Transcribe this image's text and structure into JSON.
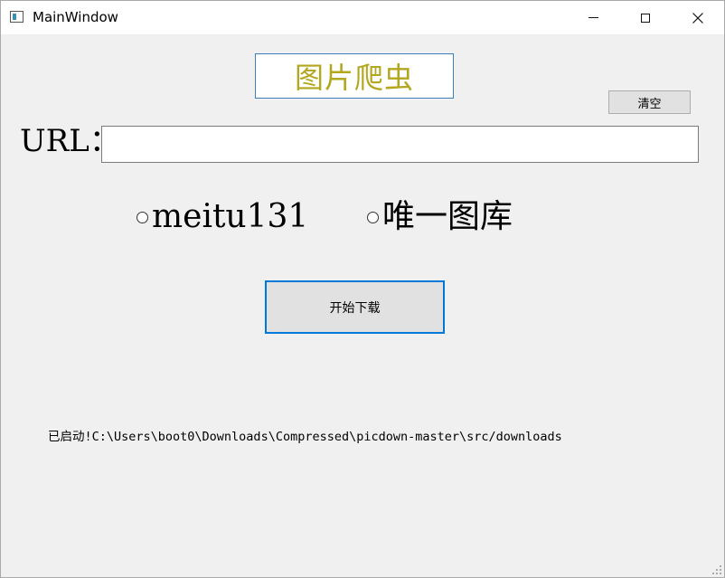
{
  "window": {
    "title": "MainWindow",
    "controls": {
      "minimize": "minimize",
      "maximize": "maximize",
      "close": "close"
    }
  },
  "header": {
    "title": "图片爬虫",
    "color": "#b3a71e"
  },
  "clear_button": {
    "label": "清空"
  },
  "url": {
    "label": "URL：",
    "value": "",
    "placeholder": ""
  },
  "sources": [
    {
      "label": "meitu131",
      "selected": false
    },
    {
      "label": "唯一图库",
      "selected": false
    }
  ],
  "start_button": {
    "label": "开始下载"
  },
  "status": {
    "text": "已启动!C:\\Users\\boot0\\Downloads\\Compressed\\picdown-master\\src/downloads"
  },
  "colors": {
    "accent": "#0078d7",
    "title_text": "#b3a71e",
    "window_bg": "#f0f0f0"
  }
}
